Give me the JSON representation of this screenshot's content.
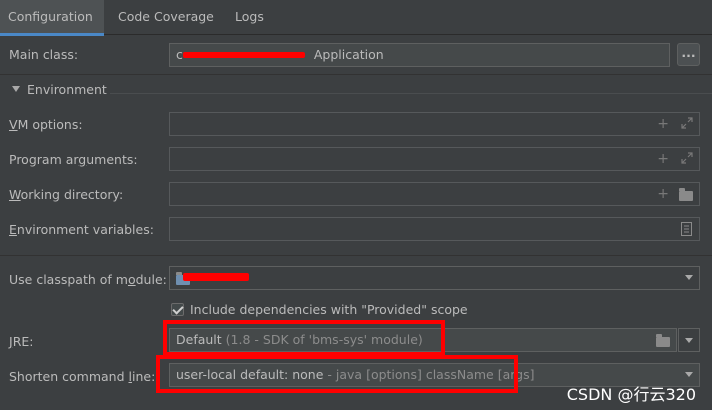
{
  "tabs": [
    {
      "label": "Configuration",
      "active": true
    },
    {
      "label": "Code Coverage",
      "active": false
    },
    {
      "label": "Logs",
      "active": false
    }
  ],
  "main_class": {
    "label": "Main class:",
    "value_prefix": "c",
    "value_suffix": "Application",
    "browse_label": "..."
  },
  "environment": {
    "section_label": "Environment",
    "vm_options": {
      "label_u": "V",
      "label_rest": "M options:",
      "value": ""
    },
    "program_arguments": {
      "label_pre": "Program ar",
      "label_u": "g",
      "label_rest": "uments:",
      "value": ""
    },
    "working_directory": {
      "label_u": "W",
      "label_rest": "orking directory:",
      "value": ""
    },
    "environment_variables": {
      "label_u": "E",
      "label_rest": "nvironment variables:",
      "value": ""
    }
  },
  "classpath": {
    "label_pre": "Use classpath of m",
    "label_u": "o",
    "label_rest": "dule:",
    "value": "",
    "include_provided": {
      "checked": true,
      "label": "Include dependencies with \"Provided\" scope"
    }
  },
  "jre": {
    "label_u": "J",
    "label_rest": "RE:",
    "value": "Default",
    "hint": "(1.8 - SDK of 'bms-sys' module)"
  },
  "shorten": {
    "label_pre": "Shorten command ",
    "label_u": "l",
    "label_rest": "ine:",
    "value": "user-local default: none",
    "hint": "- java [options] className [args]"
  },
  "watermark": "CSDN @行云320",
  "colors": {
    "redaction": "#ff0000",
    "accent": "#4a88c7"
  }
}
